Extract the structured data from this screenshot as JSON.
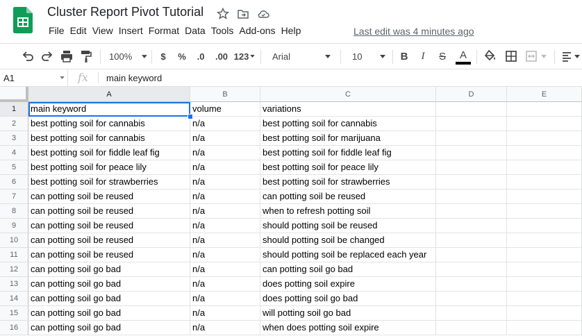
{
  "app": {
    "title": "Cluster Report Pivot Tutorial",
    "last_edit": "Last edit was 4 minutes ago",
    "icons": [
      "star-icon",
      "move-folder-icon",
      "cloud-status-icon"
    ]
  },
  "menu": [
    "File",
    "Edit",
    "View",
    "Insert",
    "Format",
    "Data",
    "Tools",
    "Add-ons",
    "Help"
  ],
  "toolbar": {
    "zoom": "100%",
    "currency": "$",
    "percent": "%",
    "decrease_decimal": ".0",
    "increase_decimal": ".00",
    "more_formats": "123",
    "font": "Arial",
    "font_size": "10",
    "bold": "B",
    "italic": "I",
    "strikethrough": "S",
    "text_color": "A",
    "text_color_value": "#000000"
  },
  "formula_bar": {
    "cell_ref": "A1",
    "fx": "fx",
    "value": "main keyword"
  },
  "sheet": {
    "columns": [
      "A",
      "B",
      "C",
      "D",
      "E"
    ],
    "row_numbers": [
      "1",
      "2",
      "3",
      "4",
      "5",
      "6",
      "7",
      "8",
      "9",
      "10",
      "11",
      "12",
      "13",
      "14",
      "15",
      "16"
    ],
    "rows": [
      [
        "main keyword",
        "volume",
        "variations"
      ],
      [
        "best potting soil for cannabis",
        "n/a",
        "best potting soil for cannabis"
      ],
      [
        "best potting soil for cannabis",
        "n/a",
        "best potting soil for marijuana"
      ],
      [
        "best potting soil for fiddle leaf fig",
        "n/a",
        "best potting soil for fiddle leaf fig"
      ],
      [
        "best potting soil for peace lily",
        "n/a",
        "best potting soil for peace lily"
      ],
      [
        "best potting soil for strawberries",
        "n/a",
        "best potting soil for strawberries"
      ],
      [
        "can potting soil be reused",
        "n/a",
        "can potting soil be reused"
      ],
      [
        "can potting soil be reused",
        "n/a",
        "when to refresh potting soil"
      ],
      [
        "can potting soil be reused",
        "n/a",
        "should potting soil be reused"
      ],
      [
        "can potting soil be reused",
        "n/a",
        "should potting soil be changed"
      ],
      [
        "can potting soil be reused",
        "n/a",
        "should potting soil be replaced each year"
      ],
      [
        "can potting soil go bad",
        "n/a",
        "can potting soil go bad"
      ],
      [
        "can potting soil go bad",
        "n/a",
        "does potting soil expire"
      ],
      [
        "can potting soil go bad",
        "n/a",
        "does potting soil go bad"
      ],
      [
        "can potting soil go bad",
        "n/a",
        "will potting soil go bad"
      ],
      [
        "can potting soil go bad",
        "n/a",
        "when does potting soil expire"
      ]
    ]
  }
}
